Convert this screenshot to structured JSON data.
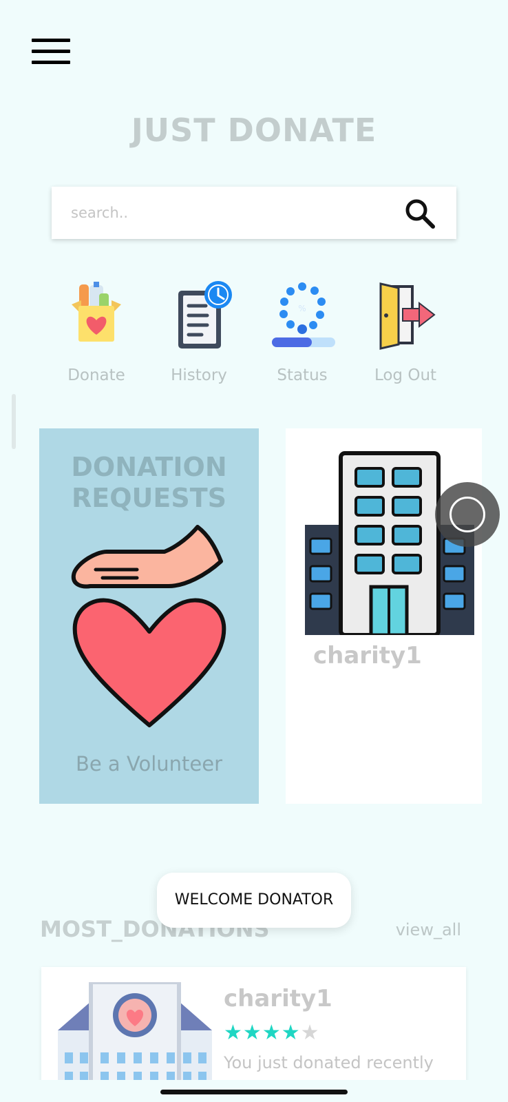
{
  "app": {
    "title": "JUST DONATE"
  },
  "search": {
    "placeholder": "search.."
  },
  "quick_actions": [
    {
      "label": "Donate",
      "icon": "donation-box-icon"
    },
    {
      "label": "History",
      "icon": "history-document-icon"
    },
    {
      "label": "Status",
      "icon": "status-loading-icon"
    },
    {
      "label": "Log Out",
      "icon": "logout-door-icon"
    }
  ],
  "cards": {
    "donation_requests": {
      "title_line1": "DONATION",
      "title_line2": "REQUESTS",
      "subtitle": "Be a Volunteer"
    },
    "charity": {
      "name": "charity1"
    }
  },
  "toast": {
    "text": "WELCOME DONATOR"
  },
  "most_donations": {
    "title": "MOST_DONATIONS",
    "view_all": "view_all",
    "items": [
      {
        "name": "charity1",
        "rating": 4,
        "max_rating": 5,
        "description": "You just donated recently"
      }
    ]
  },
  "colors": {
    "background": "#f0fcfc",
    "accent": "#1fd6c3",
    "card_blue": "#afd8e5"
  }
}
